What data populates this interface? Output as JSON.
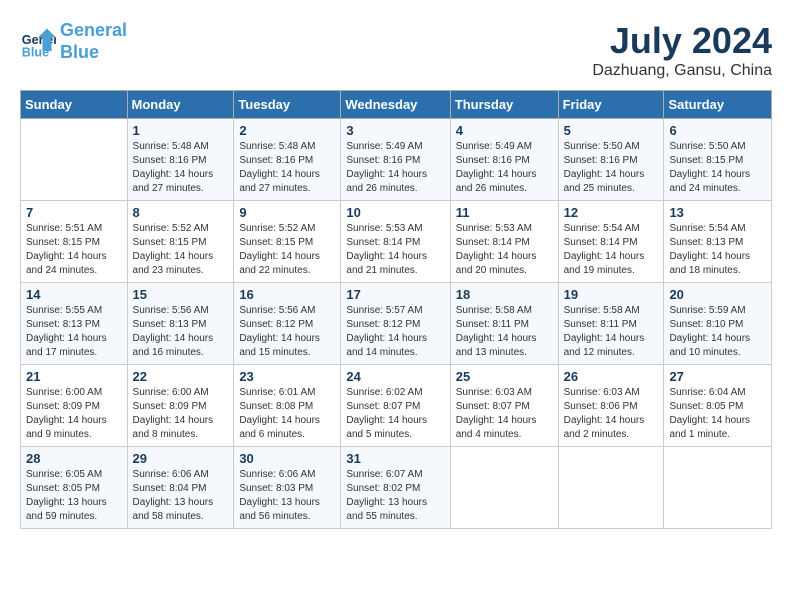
{
  "header": {
    "logo_line1": "General",
    "logo_line2": "Blue",
    "month_year": "July 2024",
    "location": "Dazhuang, Gansu, China"
  },
  "days_of_week": [
    "Sunday",
    "Monday",
    "Tuesday",
    "Wednesday",
    "Thursday",
    "Friday",
    "Saturday"
  ],
  "weeks": [
    [
      {
        "day": "",
        "content": ""
      },
      {
        "day": "1",
        "content": "Sunrise: 5:48 AM\nSunset: 8:16 PM\nDaylight: 14 hours\nand 27 minutes."
      },
      {
        "day": "2",
        "content": "Sunrise: 5:48 AM\nSunset: 8:16 PM\nDaylight: 14 hours\nand 27 minutes."
      },
      {
        "day": "3",
        "content": "Sunrise: 5:49 AM\nSunset: 8:16 PM\nDaylight: 14 hours\nand 26 minutes."
      },
      {
        "day": "4",
        "content": "Sunrise: 5:49 AM\nSunset: 8:16 PM\nDaylight: 14 hours\nand 26 minutes."
      },
      {
        "day": "5",
        "content": "Sunrise: 5:50 AM\nSunset: 8:16 PM\nDaylight: 14 hours\nand 25 minutes."
      },
      {
        "day": "6",
        "content": "Sunrise: 5:50 AM\nSunset: 8:15 PM\nDaylight: 14 hours\nand 24 minutes."
      }
    ],
    [
      {
        "day": "7",
        "content": "Sunrise: 5:51 AM\nSunset: 8:15 PM\nDaylight: 14 hours\nand 24 minutes."
      },
      {
        "day": "8",
        "content": "Sunrise: 5:52 AM\nSunset: 8:15 PM\nDaylight: 14 hours\nand 23 minutes."
      },
      {
        "day": "9",
        "content": "Sunrise: 5:52 AM\nSunset: 8:15 PM\nDaylight: 14 hours\nand 22 minutes."
      },
      {
        "day": "10",
        "content": "Sunrise: 5:53 AM\nSunset: 8:14 PM\nDaylight: 14 hours\nand 21 minutes."
      },
      {
        "day": "11",
        "content": "Sunrise: 5:53 AM\nSunset: 8:14 PM\nDaylight: 14 hours\nand 20 minutes."
      },
      {
        "day": "12",
        "content": "Sunrise: 5:54 AM\nSunset: 8:14 PM\nDaylight: 14 hours\nand 19 minutes."
      },
      {
        "day": "13",
        "content": "Sunrise: 5:54 AM\nSunset: 8:13 PM\nDaylight: 14 hours\nand 18 minutes."
      }
    ],
    [
      {
        "day": "14",
        "content": "Sunrise: 5:55 AM\nSunset: 8:13 PM\nDaylight: 14 hours\nand 17 minutes."
      },
      {
        "day": "15",
        "content": "Sunrise: 5:56 AM\nSunset: 8:13 PM\nDaylight: 14 hours\nand 16 minutes."
      },
      {
        "day": "16",
        "content": "Sunrise: 5:56 AM\nSunset: 8:12 PM\nDaylight: 14 hours\nand 15 minutes."
      },
      {
        "day": "17",
        "content": "Sunrise: 5:57 AM\nSunset: 8:12 PM\nDaylight: 14 hours\nand 14 minutes."
      },
      {
        "day": "18",
        "content": "Sunrise: 5:58 AM\nSunset: 8:11 PM\nDaylight: 14 hours\nand 13 minutes."
      },
      {
        "day": "19",
        "content": "Sunrise: 5:58 AM\nSunset: 8:11 PM\nDaylight: 14 hours\nand 12 minutes."
      },
      {
        "day": "20",
        "content": "Sunrise: 5:59 AM\nSunset: 8:10 PM\nDaylight: 14 hours\nand 10 minutes."
      }
    ],
    [
      {
        "day": "21",
        "content": "Sunrise: 6:00 AM\nSunset: 8:09 PM\nDaylight: 14 hours\nand 9 minutes."
      },
      {
        "day": "22",
        "content": "Sunrise: 6:00 AM\nSunset: 8:09 PM\nDaylight: 14 hours\nand 8 minutes."
      },
      {
        "day": "23",
        "content": "Sunrise: 6:01 AM\nSunset: 8:08 PM\nDaylight: 14 hours\nand 6 minutes."
      },
      {
        "day": "24",
        "content": "Sunrise: 6:02 AM\nSunset: 8:07 PM\nDaylight: 14 hours\nand 5 minutes."
      },
      {
        "day": "25",
        "content": "Sunrise: 6:03 AM\nSunset: 8:07 PM\nDaylight: 14 hours\nand 4 minutes."
      },
      {
        "day": "26",
        "content": "Sunrise: 6:03 AM\nSunset: 8:06 PM\nDaylight: 14 hours\nand 2 minutes."
      },
      {
        "day": "27",
        "content": "Sunrise: 6:04 AM\nSunset: 8:05 PM\nDaylight: 14 hours\nand 1 minute."
      }
    ],
    [
      {
        "day": "28",
        "content": "Sunrise: 6:05 AM\nSunset: 8:05 PM\nDaylight: 13 hours\nand 59 minutes."
      },
      {
        "day": "29",
        "content": "Sunrise: 6:06 AM\nSunset: 8:04 PM\nDaylight: 13 hours\nand 58 minutes."
      },
      {
        "day": "30",
        "content": "Sunrise: 6:06 AM\nSunset: 8:03 PM\nDaylight: 13 hours\nand 56 minutes."
      },
      {
        "day": "31",
        "content": "Sunrise: 6:07 AM\nSunset: 8:02 PM\nDaylight: 13 hours\nand 55 minutes."
      },
      {
        "day": "",
        "content": ""
      },
      {
        "day": "",
        "content": ""
      },
      {
        "day": "",
        "content": ""
      }
    ]
  ]
}
